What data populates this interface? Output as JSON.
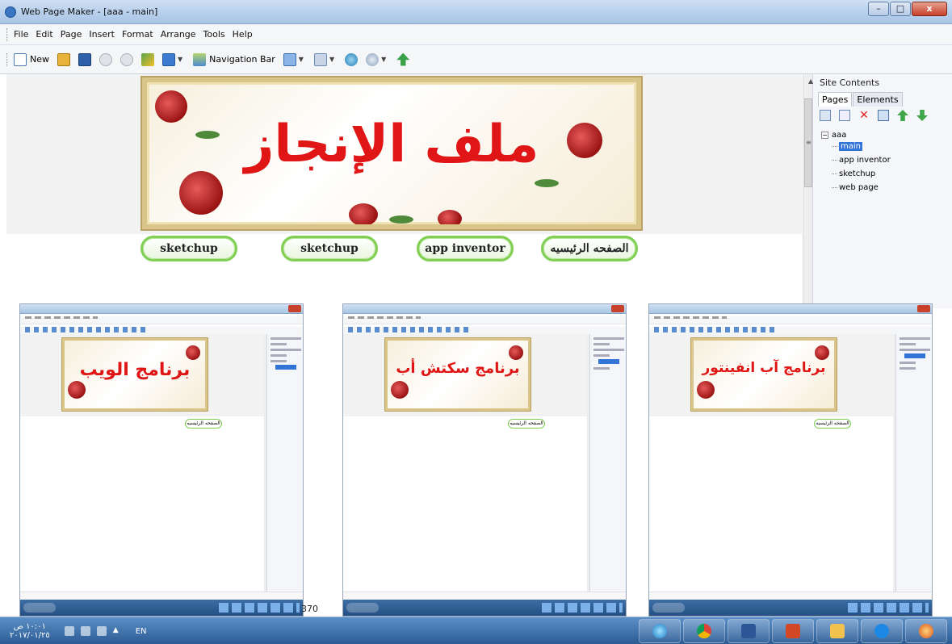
{
  "window": {
    "title": "Web Page Maker - [aaa - main]",
    "minimize": "–",
    "maximize": "□",
    "close": "x"
  },
  "menu": [
    "File",
    "Edit",
    "Page",
    "Insert",
    "Format",
    "Arrange",
    "Tools",
    "Help"
  ],
  "toolbar": {
    "new_label": "New",
    "navbar_label": "Navigation Bar"
  },
  "banner": {
    "title": "ملف الإنجاز"
  },
  "nav_buttons": [
    "sketchup",
    "sketchup",
    "app inventor",
    "الصفحه الرئيسيه"
  ],
  "site_panel": {
    "title": "Site Contents",
    "tabs": [
      "Pages",
      "Elements"
    ],
    "root": "aaa",
    "pages": [
      "main",
      "app inventor",
      "sketchup",
      "web page"
    ],
    "selected": "main"
  },
  "thumbnails": [
    {
      "banner": "برنامج الويب",
      "button": "الصفحه الرئيسيه"
    },
    {
      "banner": "برنامج سكتش أب",
      "button": "الصفحه الرئيسيه"
    },
    {
      "banner": "برنامج آب انفينتور",
      "button": "الصفحه الرئيسيه"
    }
  ],
  "page_number": "370",
  "taskbar": {
    "clock_time": "١٠:٠١ ص",
    "clock_date": "٢٠١٧/٠١/٢٥",
    "language": "EN"
  }
}
